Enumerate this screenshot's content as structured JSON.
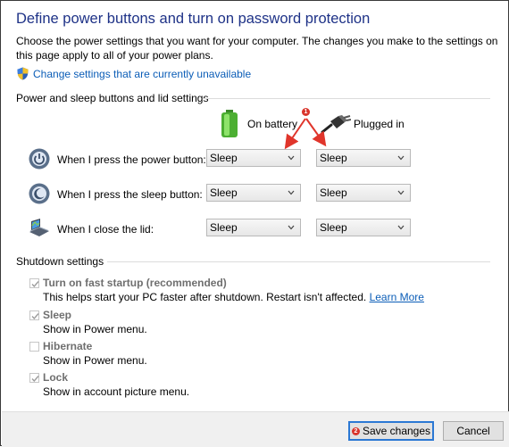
{
  "window": {
    "title": "Define power buttons and turn on password protection",
    "description": "Choose the power settings that you want for your computer. The changes you make to the settings on this page apply to all of your power plans.",
    "change_link": "Change settings that are currently unavailable"
  },
  "power_section": {
    "heading": "Power and sleep buttons and lid settings",
    "col_battery": "On battery",
    "col_plugged": "Plugged in",
    "rows": [
      {
        "label": "When I press the power button:",
        "battery": "Sleep",
        "plugged": "Sleep",
        "icon": "power-button-icon"
      },
      {
        "label": "When I press the sleep button:",
        "battery": "Sleep",
        "plugged": "Sleep",
        "icon": "sleep-button-icon"
      },
      {
        "label": "When I close the lid:",
        "battery": "Sleep",
        "plugged": "Sleep",
        "icon": "laptop-lid-icon"
      }
    ]
  },
  "shutdown_section": {
    "heading": "Shutdown settings",
    "options": [
      {
        "title": "Turn on fast startup (recommended)",
        "desc": "This helps start your PC faster after shutdown. Restart isn't affected.",
        "link": "Learn More",
        "checked": true
      },
      {
        "title": "Sleep",
        "desc": "Show in Power menu.",
        "checked": true
      },
      {
        "title": "Hibernate",
        "desc": "Show in Power menu.",
        "checked": false
      },
      {
        "title": "Lock",
        "desc": "Show in account picture menu.",
        "checked": true
      }
    ]
  },
  "footer": {
    "save_label": "Save changes",
    "cancel_label": "Cancel",
    "badge_save": "2"
  },
  "annotations": {
    "badge_arrows": "1",
    "arrow_color": "#e0352b"
  }
}
